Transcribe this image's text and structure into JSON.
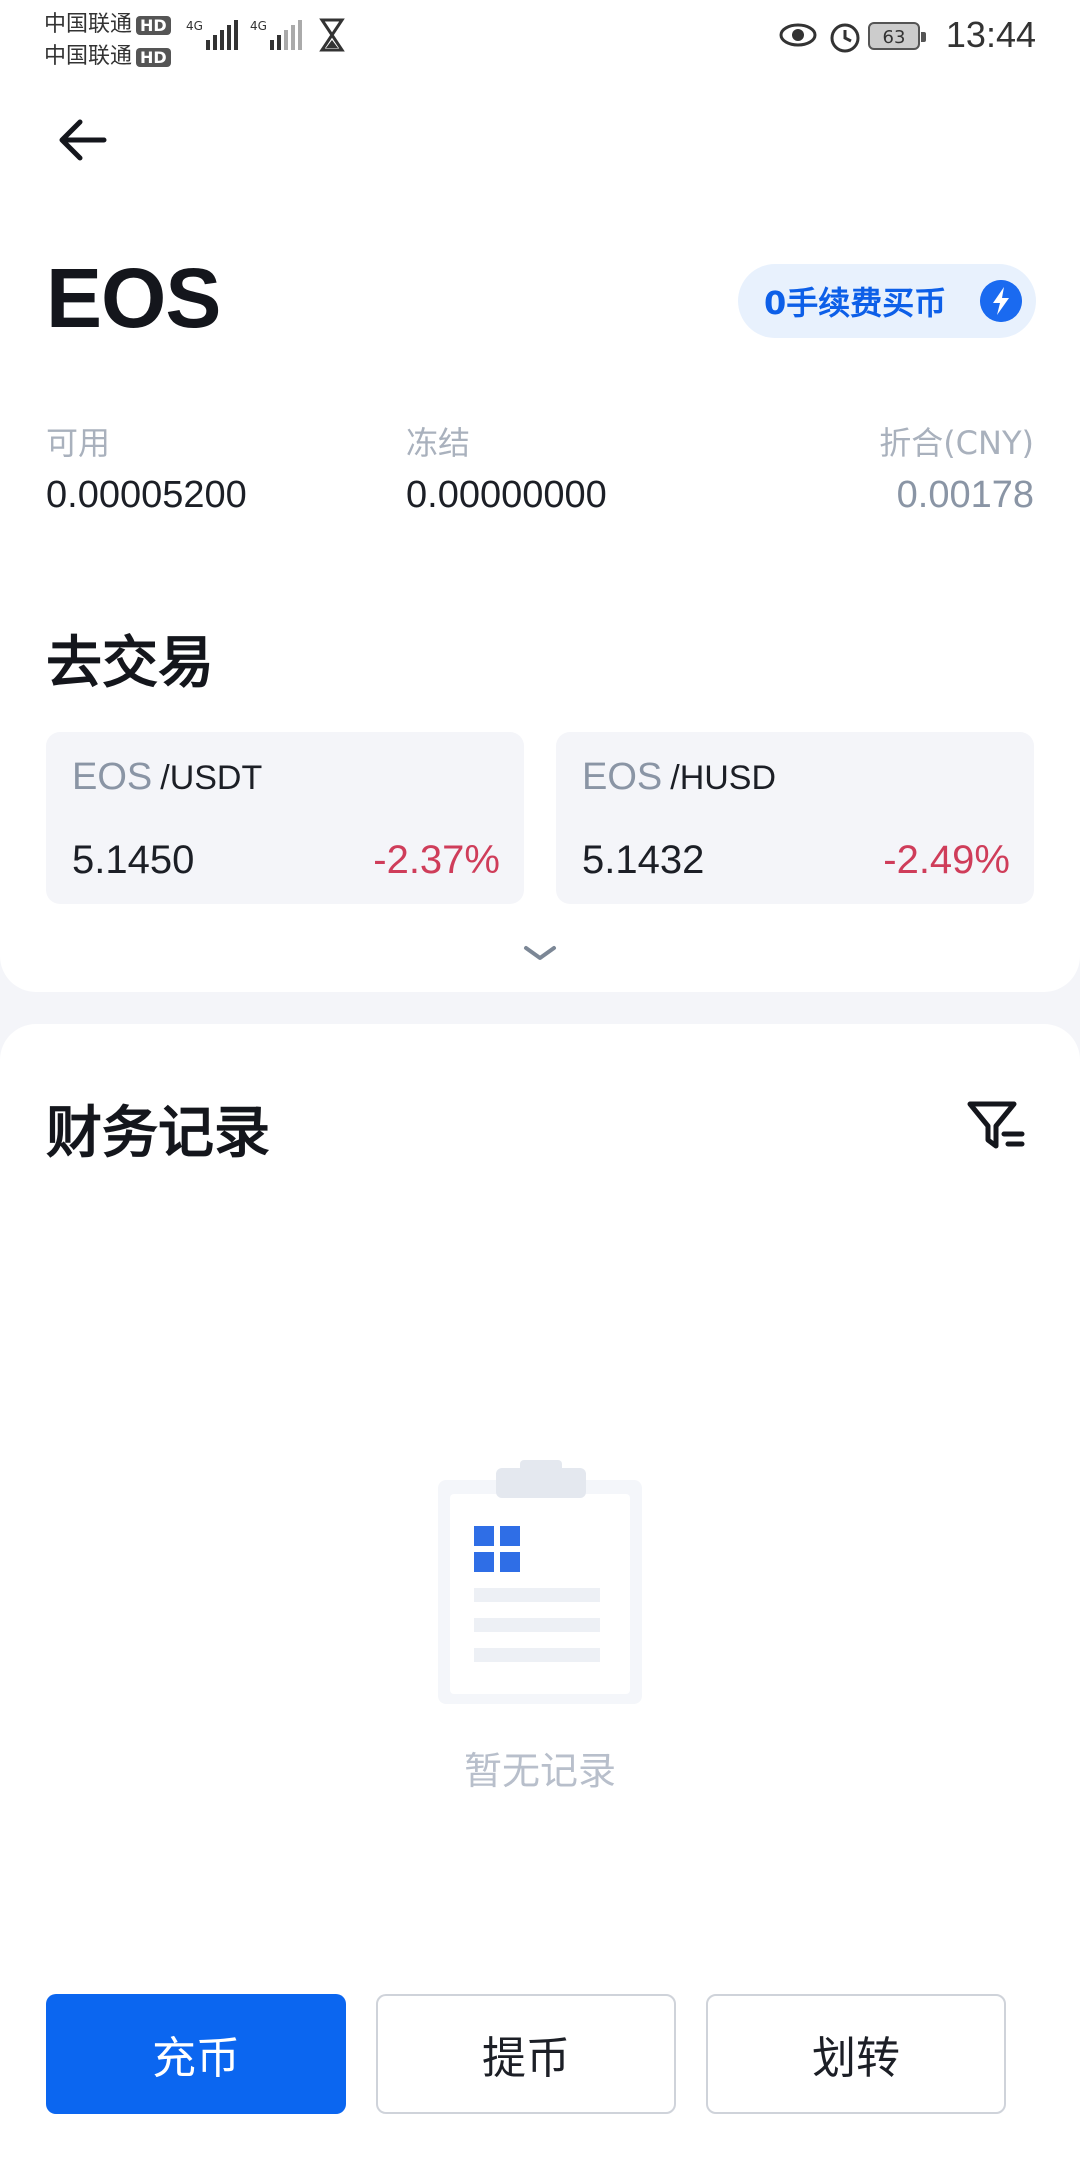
{
  "status_bar": {
    "carrier1": "中国联通",
    "carrier2": "中国联通",
    "hd": "HD",
    "net1": "4G",
    "net2": "4G",
    "battery": "63",
    "time": "13:44"
  },
  "header": {
    "coin": "EOS",
    "buy_button": "0手续费买币"
  },
  "balances": {
    "available_label": "可用",
    "available_value": "0.00005200",
    "frozen_label": "冻结",
    "frozen_value": "0.00000000",
    "cny_label": "折合(CNY)",
    "cny_value": "0.00178"
  },
  "trade": {
    "title": "去交易",
    "markets": [
      {
        "base": "EOS",
        "quote": "/USDT",
        "price": "5.1450",
        "change": "-2.37%"
      },
      {
        "base": "EOS",
        "quote": "/HUSD",
        "price": "5.1432",
        "change": "-2.49%"
      }
    ]
  },
  "records": {
    "title": "财务记录",
    "empty_text": "暂无记录"
  },
  "actions": {
    "deposit": "充币",
    "withdraw": "提币",
    "transfer": "划转"
  },
  "colors": {
    "accent": "#0b66f0",
    "negative": "#cf3d5a"
  }
}
